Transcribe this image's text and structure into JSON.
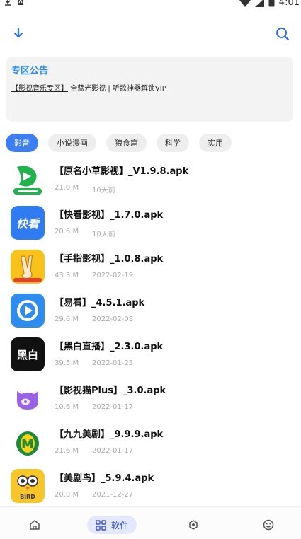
{
  "status_bar": {
    "time": "4:01"
  },
  "notice": {
    "title": "专区公告",
    "link_text": "【影视音乐专区】",
    "text": "全蓝光影视 | 听歌神器解锁VIP"
  },
  "categories": [
    {
      "label": "影音",
      "active": true
    },
    {
      "label": "小说漫画",
      "active": false
    },
    {
      "label": "狼食窟",
      "active": false
    },
    {
      "label": "科学",
      "active": false
    },
    {
      "label": "实用",
      "active": false
    }
  ],
  "apps": [
    {
      "name": "【原名小草影视】_V1.9.8.apk",
      "size": "21.0 M",
      "date": "10天前",
      "icon": "grass-video-icon"
    },
    {
      "name": "【快看影视】_1.7.0.apk",
      "size": "20.6 M",
      "date": "10天前",
      "icon": "kuaikan-icon",
      "icon_text": "快看"
    },
    {
      "name": "【手指影视】_1.0.8.apk",
      "size": "43.3 M",
      "date": "2022-02-19",
      "icon": "finger-icon"
    },
    {
      "name": "【易看】_4.5.1.apk",
      "size": "29.6 M",
      "date": "2022-02-08",
      "icon": "yikan-icon"
    },
    {
      "name": "【黑白直播】_2.3.0.apk",
      "size": "39.5 M",
      "date": "2022-01-23",
      "icon": "heibai-icon",
      "icon_text": "黑白"
    },
    {
      "name": "【影视猫Plus】_3.0.apk",
      "size": "10.6 M",
      "date": "2022-01-17",
      "icon": "cat-icon"
    },
    {
      "name": "【九九美剧】_9.9.9.apk",
      "size": "21.6 M",
      "date": "2022-01-17",
      "icon": "jiujiu-icon",
      "icon_text": "M"
    },
    {
      "name": "【美剧鸟】_5.9.4.apk",
      "size": "20.0 M",
      "date": "2021-12-27",
      "icon": "bird-icon",
      "icon_text": "BIRD"
    }
  ],
  "bottom_nav": {
    "software_label": "软件"
  },
  "colors": {
    "accent": "#3d7ff3",
    "notice_title": "#2d8ce8",
    "nav_active_bg": "#e4e8fc"
  }
}
